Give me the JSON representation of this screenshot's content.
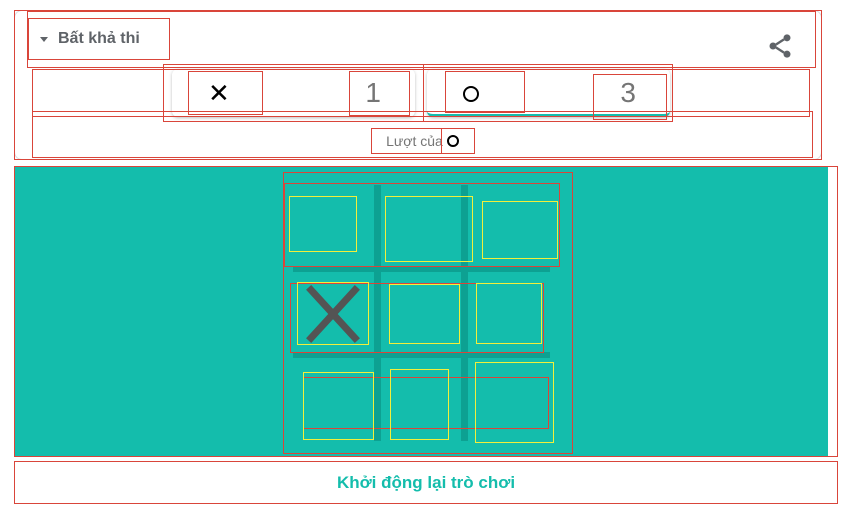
{
  "header": {
    "difficulty_label": "Bất khả thi",
    "difficulty_icon": "caret-down-icon",
    "share_icon": "share-icon"
  },
  "scores": [
    {
      "symbol": "✕",
      "value": "1",
      "active": false
    },
    {
      "symbol": "O",
      "value": "3",
      "active": true
    }
  ],
  "turn": {
    "label": "Lượt của",
    "symbol": "O"
  },
  "board": {
    "cells": [
      "",
      "",
      "",
      "X",
      "",
      "",
      "",
      "",
      ""
    ],
    "colors": {
      "background": "#14bdac",
      "lines": "#0da192",
      "x": "#545454"
    }
  },
  "restart_label": "Khởi động lại trò chơi"
}
